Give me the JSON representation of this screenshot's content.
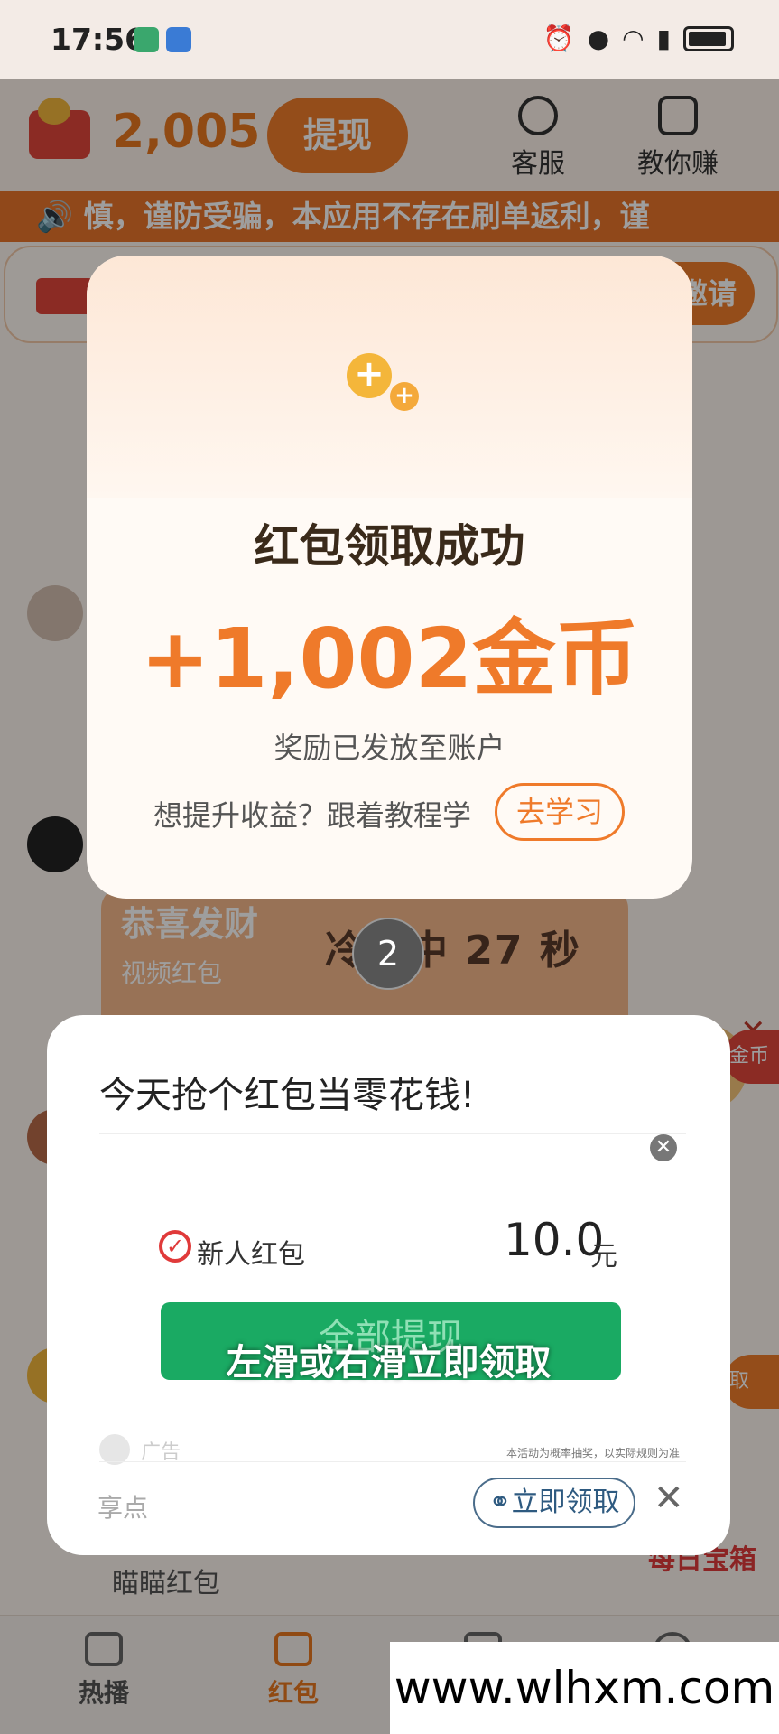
{
  "status_bar": {
    "time": "17:56"
  },
  "header": {
    "coin_balance": "2,005",
    "withdraw_label": "提现",
    "service_label": "客服",
    "earn_label": "教你赚"
  },
  "marquee": {
    "text": "慎，谨防受骗，本应用不存在刷单返利，谨"
  },
  "invite": {
    "label": "邀请"
  },
  "background_chat": {
    "title": "恭喜发财",
    "subtitle": "视频红包",
    "cooldown": "冷却中 27 秒",
    "count_badge": "2",
    "side_pill": "金币",
    "side_pill_2": "取",
    "daily_chest": "每日宝箱",
    "footer_label": "瞄瞄红包"
  },
  "success_modal": {
    "title": "红包领取成功",
    "amount": "+1,002金币",
    "note": "奖励已发放至账户",
    "learn_prompt": "想提升收益？跟着教程学",
    "learn_button": "去学习"
  },
  "ad_modal": {
    "title": "今天抢个红包当零花钱!",
    "reward_label": "新人红包",
    "reward_value": "10.0",
    "reward_unit": "元",
    "green_button": "全部提现",
    "swipe_hint": "左滑或右滑立即领取",
    "ad_tag": "广告",
    "disclaimer": "本活动为概率抽奖，以实际规则为准",
    "brand": "享点",
    "claim_button": "立即领取"
  },
  "bottom_nav": {
    "items": [
      {
        "label": "热播"
      },
      {
        "label": "红包"
      },
      {
        "label": ""
      },
      {
        "label": ""
      }
    ]
  },
  "watermark": "www.wlhxm.com",
  "colors": {
    "accent": "#ef7a2a",
    "green": "#1aaa63",
    "red": "#e0463a"
  }
}
